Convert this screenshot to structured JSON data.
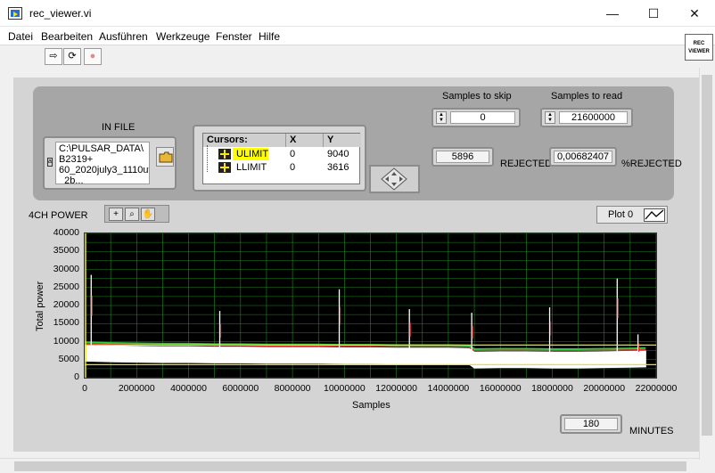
{
  "window": {
    "title": "rec_viewer.vi",
    "minimize": "—",
    "maximize": "☐",
    "close": "✕"
  },
  "menu": [
    "Datei",
    "Bearbeiten",
    "Ausführen",
    "Werkzeuge",
    "Fenster",
    "Hilfe"
  ],
  "toolbar": {
    "run": "⇨",
    "run_continuous": "⟳",
    "abort": "●",
    "vi_icon_line1": "REC",
    "vi_icon_line2": "VIEWER"
  },
  "in_file": {
    "label": "IN FILE",
    "path_lines": [
      "C:\\PULSAR_DATA\\",
      "B2319+",
      "60_2020july3_1110ut",
      "_2b..."
    ]
  },
  "cursors": {
    "headers": [
      "Cursors:",
      "X",
      "Y"
    ],
    "rows": [
      {
        "name": "ULIMIT",
        "x": "0",
        "y": "9040"
      },
      {
        "name": "LLIMIT",
        "x": "0",
        "y": "3616"
      }
    ]
  },
  "samples_to_skip": {
    "label": "Samples to skip",
    "value": "0"
  },
  "samples_to_read": {
    "label": "Samples to read",
    "value": "21600000"
  },
  "rejected": {
    "value": "5896",
    "label": "REJECTED"
  },
  "percent_rejected": {
    "value": "0,00682407",
    "label": "%REJECTED"
  },
  "graph": {
    "label": "4CH POWER",
    "legend_label": "Plot 0"
  },
  "minutes": {
    "value": "180",
    "label": "MINUTES"
  },
  "colors": {
    "plot_background": "#000000",
    "grid": "#1f8a1f",
    "trace_white": "#ffffff",
    "trace_green": "#2ecc40",
    "trace_red": "#e03030",
    "cursor_line": "#e8e800",
    "cursor_highlight": "#ffff00"
  },
  "chart_data": {
    "type": "line",
    "xlabel": "Samples",
    "ylabel": "Total power",
    "xlim": [
      0,
      22000000
    ],
    "ylim": [
      0,
      40000
    ],
    "x_ticks": [
      "0",
      "2000000",
      "4000000",
      "6000000",
      "8000000",
      "10000000",
      "12000000",
      "14000000",
      "16000000",
      "18000000",
      "20000000",
      "22000000"
    ],
    "y_ticks": [
      "0",
      "5000",
      "10000",
      "15000",
      "20000",
      "25000",
      "30000",
      "35000",
      "40000"
    ],
    "grid": true,
    "cursor_lines": [
      {
        "name": "ULIMIT",
        "y": 9040
      },
      {
        "name": "LLIMIT",
        "y": 3616
      }
    ],
    "series": [
      {
        "name": "Plot 0",
        "x": [
          0,
          1000000,
          2000000,
          3000000,
          4000000,
          5000000,
          6000000,
          7000000,
          8000000,
          9000000,
          10000000,
          11000000,
          12000000,
          13000000,
          14000000,
          14800000,
          15000000,
          16000000,
          17000000,
          18000000,
          19000000,
          20000000,
          21000000,
          21600000
        ],
        "y": [
          7200,
          7000,
          6900,
          6800,
          6800,
          6700,
          6700,
          6600,
          6600,
          6600,
          6500,
          6500,
          6400,
          6400,
          6400,
          6300,
          5300,
          5400,
          5400,
          5300,
          5300,
          5400,
          5500,
          5600
        ],
        "spikes": [
          {
            "x": 250000,
            "y": 28500
          },
          {
            "x": 5200000,
            "y": 18500
          },
          {
            "x": 9800000,
            "y": 24500
          },
          {
            "x": 12500000,
            "y": 19000
          },
          {
            "x": 14900000,
            "y": 18000
          },
          {
            "x": 17900000,
            "y": 19500
          },
          {
            "x": 20500000,
            "y": 27500
          },
          {
            "x": 21300000,
            "y": 12000
          }
        ]
      }
    ]
  }
}
